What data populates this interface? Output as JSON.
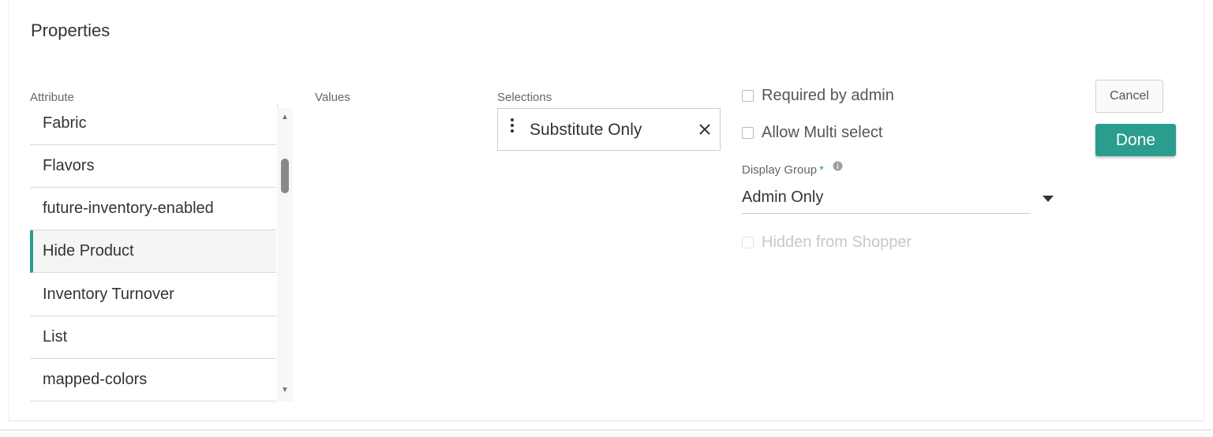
{
  "title": "Properties",
  "columns": {
    "attribute": "Attribute",
    "values": "Values",
    "selections": "Selections"
  },
  "attributes": [
    {
      "label": "Fabric",
      "selected": false
    },
    {
      "label": "Flavors",
      "selected": false
    },
    {
      "label": "future-inventory-enabled",
      "selected": false
    },
    {
      "label": "Hide Product",
      "selected": true
    },
    {
      "label": "Inventory Turnover",
      "selected": false
    },
    {
      "label": "List",
      "selected": false
    },
    {
      "label": "mapped-colors",
      "selected": false
    }
  ],
  "selections": [
    {
      "label": "Substitute Only"
    }
  ],
  "options": {
    "required_by_admin": {
      "label": "Required by admin",
      "checked": false
    },
    "allow_multi_select": {
      "label": "Allow Multi select",
      "checked": false
    },
    "hidden_from_shopper": {
      "label": "Hidden from Shopper",
      "checked": false,
      "disabled": true
    }
  },
  "display_group": {
    "label": "Display Group",
    "required_mark": "*",
    "value": "Admin Only"
  },
  "buttons": {
    "cancel": "Cancel",
    "done": "Done"
  },
  "colors": {
    "accent": "#2a9d8f"
  },
  "icons": {
    "drag": "drag-handle-icon",
    "remove": "close-icon",
    "info": "info-icon",
    "dropdown": "caret-down-icon",
    "scroll_up": "arrow-up-icon",
    "scroll_down": "arrow-down-icon"
  }
}
